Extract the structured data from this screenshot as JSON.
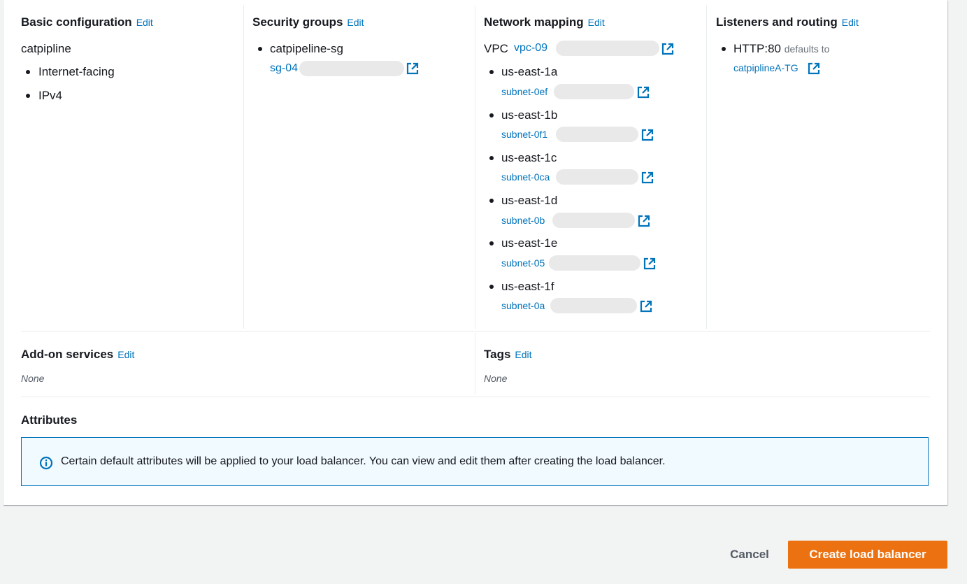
{
  "basic": {
    "title": "Basic configuration",
    "edit": "Edit",
    "name": "catpipline",
    "items": [
      "Internet-facing",
      "IPv4"
    ]
  },
  "security": {
    "title": "Security groups",
    "edit": "Edit",
    "group_name": "catpipeline-sg",
    "group_id": "sg-04"
  },
  "network": {
    "title": "Network mapping",
    "edit": "Edit",
    "vpc_label": "VPC",
    "vpc_id": "vpc-09",
    "zones": [
      {
        "zone": "us-east-1a",
        "subnet": "subnet-0ef"
      },
      {
        "zone": "us-east-1b",
        "subnet": "subnet-0f1"
      },
      {
        "zone": "us-east-1c",
        "subnet": "subnet-0ca"
      },
      {
        "zone": "us-east-1d",
        "subnet": "subnet-0b"
      },
      {
        "zone": "us-east-1e",
        "subnet": "subnet-05"
      },
      {
        "zone": "us-east-1f",
        "subnet": "subnet-0a"
      }
    ]
  },
  "listeners": {
    "title": "Listeners and routing",
    "edit": "Edit",
    "listener": "HTTP:80",
    "defaults_to": "defaults to",
    "target_group": "catpiplineA-TG"
  },
  "addons": {
    "title": "Add-on services",
    "edit": "Edit",
    "value": "None"
  },
  "tags": {
    "title": "Tags",
    "edit": "Edit",
    "value": "None"
  },
  "attributes": {
    "title": "Attributes",
    "info": "Certain default attributes will be applied to your load balancer. You can view and edit them after creating the load balancer."
  },
  "footer": {
    "cancel": "Cancel",
    "create": "Create load balancer"
  },
  "colors": {
    "link": "#0073bb",
    "primary_button": "#ec7211",
    "info_border": "#0073bb",
    "info_background": "#f1faff"
  },
  "icons": {
    "external_link": "external-link-icon",
    "info": "info-icon"
  }
}
